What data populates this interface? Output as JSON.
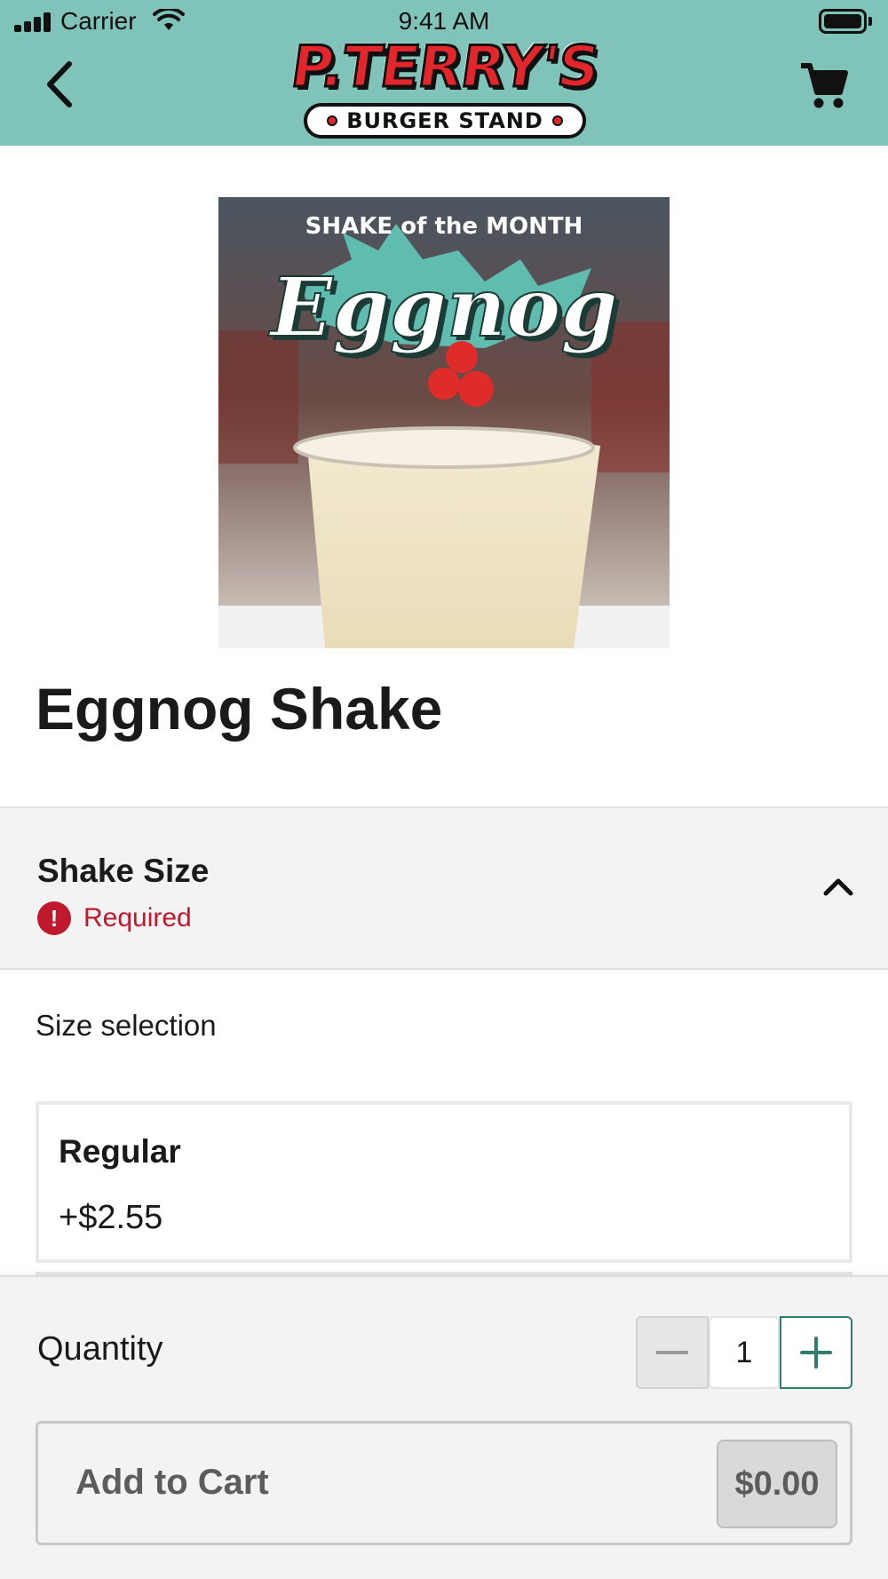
{
  "status_bar": {
    "carrier": "Carrier",
    "time": "9:41 AM"
  },
  "header": {
    "brand_wordmark": "P.TERRY'S",
    "brand_tagline": "BURGER STAND",
    "back_icon": "chevron-left-icon",
    "cart_icon": "shopping-cart-icon",
    "background_color": "#80c4b9"
  },
  "product": {
    "image_caption_top": "SHAKE of the MONTH",
    "image_caption_main": "Eggnog",
    "name": "Eggnog Shake"
  },
  "modifier_group": {
    "title": "Shake Size",
    "required_label": "Required",
    "caption": "Size selection",
    "expanded": true,
    "options": [
      {
        "name": "Regular",
        "price": "+$2.55"
      }
    ],
    "required_color": "#c0182d"
  },
  "footer": {
    "quantity_label": "Quantity",
    "quantity_value": "1",
    "add_to_cart_label": "Add to Cart",
    "total_price": "$0.00",
    "accent_color": "#2e7d6f"
  }
}
